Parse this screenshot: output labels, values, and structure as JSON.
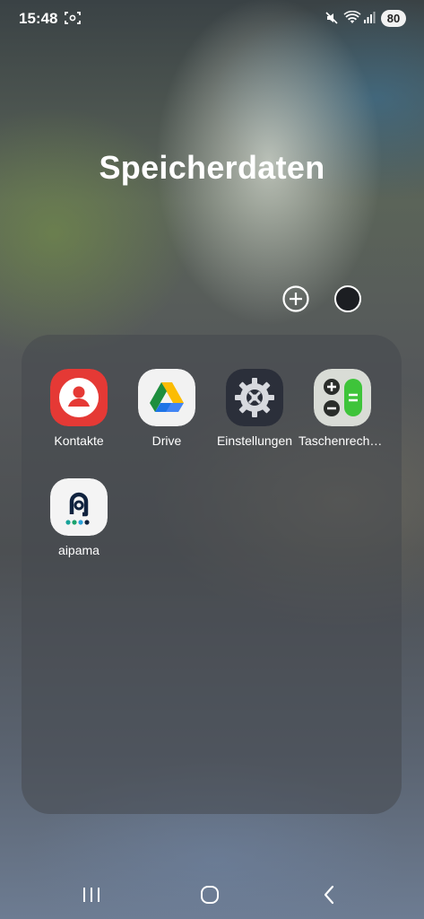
{
  "status_bar": {
    "time": "15:48",
    "battery_level": "80",
    "icons": [
      "screenshot-icon",
      "mute-icon",
      "wifi-icon",
      "signal-icon",
      "battery-icon"
    ]
  },
  "folder": {
    "title": "Speicherdaten",
    "add_icon": "plus-circle-icon",
    "color_icon": "folder-color-icon",
    "apps": [
      {
        "label": "Kontakte",
        "icon": "contacts-icon",
        "color": "#e53935"
      },
      {
        "label": "Drive",
        "icon": "google-drive-icon",
        "color": "#f2f2f2"
      },
      {
        "label": "Einstellungen",
        "icon": "settings-gear-icon",
        "color": "#2b2f3a"
      },
      {
        "label": "Taschenrechn...",
        "icon": "calculator-icon",
        "color": "#d9dcd6"
      },
      {
        "label": "aipama",
        "icon": "aipama-icon",
        "color": "#f4f4f4"
      }
    ]
  },
  "nav_bar": {
    "icons": [
      "recent-apps-icon",
      "home-icon",
      "back-icon"
    ]
  }
}
